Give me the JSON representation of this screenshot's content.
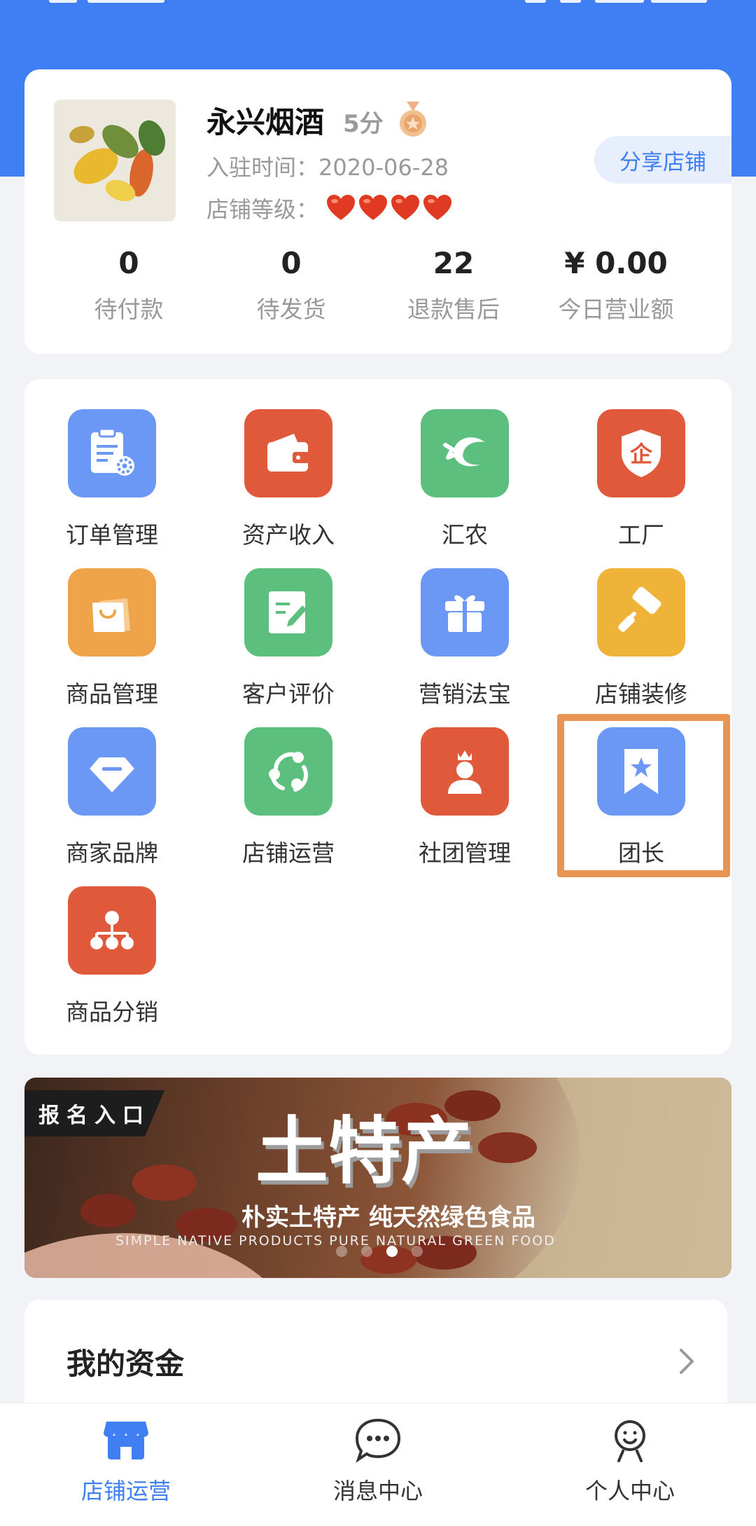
{
  "colors": {
    "primary": "#3f7ef3",
    "orange": "#e0593a",
    "green": "#5cbf7e",
    "yellow": "#efb33a",
    "blue_icon": "#6a98f4",
    "highlight": "#ea9451"
  },
  "shop": {
    "name": "永兴烟酒",
    "score": "5分",
    "join_label": "入驻时间：",
    "join_date": "2020-06-28",
    "level_label": "店铺等级：",
    "level_hearts": 4,
    "share_label": "分享店铺"
  },
  "stats": [
    {
      "value": "0",
      "label": "待付款"
    },
    {
      "value": "0",
      "label": "待发货"
    },
    {
      "value": "22",
      "label": "退款售后"
    },
    {
      "value": "¥ 0.00",
      "label": "今日营业额"
    }
  ],
  "menu": [
    {
      "label": "订单管理",
      "icon": "clipboard-gear-icon",
      "color": "#6a98f4"
    },
    {
      "label": "资产收入",
      "icon": "wallet-icon",
      "color": "#e0593a"
    },
    {
      "label": "汇农",
      "icon": "huinong-logo-icon",
      "color": "#5cbf7e"
    },
    {
      "label": "工厂",
      "icon": "factory-shield-icon",
      "color": "#e0593a"
    },
    {
      "label": "商品管理",
      "icon": "shopping-bag-icon",
      "color": "#efa44a"
    },
    {
      "label": "客户评价",
      "icon": "edit-note-icon",
      "color": "#5cbf7e"
    },
    {
      "label": "营销法宝",
      "icon": "gift-icon",
      "color": "#6a98f4"
    },
    {
      "label": "店铺装修",
      "icon": "paint-roller-icon",
      "color": "#efb33a"
    },
    {
      "label": "商家品牌",
      "icon": "brand-diamond-icon",
      "color": "#6a98f4"
    },
    {
      "label": "店铺运营",
      "icon": "share-nodes-icon",
      "color": "#5cbf7e"
    },
    {
      "label": "社团管理",
      "icon": "crowned-person-icon",
      "color": "#e0593a"
    },
    {
      "label": "团长",
      "icon": "star-bookmark-icon",
      "color": "#6a98f4"
    },
    {
      "label": "商品分销",
      "icon": "org-chart-icon",
      "color": "#e0593a"
    }
  ],
  "banner": {
    "tag": "报名入口",
    "title": "土特产",
    "subtitle": "朴实土特产 纯天然绿色食品",
    "english": "SIMPLE NATIVE PRODUCTS PURE NATURAL GREEN FOOD",
    "active_dot": 3,
    "dot_count": 4
  },
  "funds": {
    "title": "我的资金"
  },
  "nav": [
    {
      "label": "店铺运营",
      "icon": "shop-icon",
      "active": true
    },
    {
      "label": "消息中心",
      "icon": "chat-bubble-icon",
      "active": false
    },
    {
      "label": "个人中心",
      "icon": "user-face-icon",
      "active": false
    }
  ]
}
